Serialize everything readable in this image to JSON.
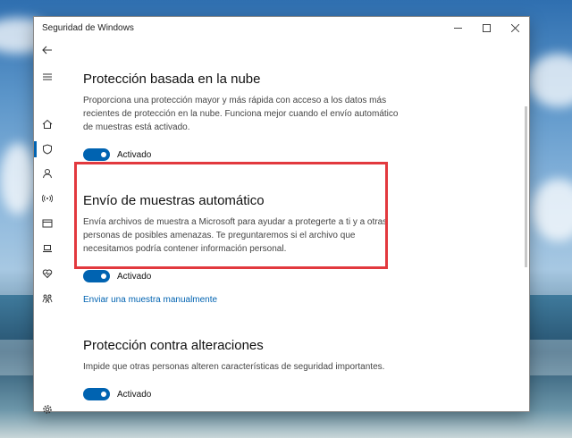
{
  "window": {
    "title": "Seguridad de Windows",
    "controls": [
      "minimize-icon",
      "maximize-icon",
      "close-icon"
    ]
  },
  "nav": {
    "items": [
      {
        "icon": "back-arrow-icon"
      },
      {
        "icon": "hamburger-menu-icon"
      },
      {
        "icon": "home-icon"
      },
      {
        "icon": "shield-icon",
        "active": true
      },
      {
        "icon": "account-icon"
      },
      {
        "icon": "wifi-antenna-icon"
      },
      {
        "icon": "app-browser-icon"
      },
      {
        "icon": "laptop-icon"
      },
      {
        "icon": "heart-health-icon"
      },
      {
        "icon": "family-icon"
      },
      {
        "icon": "gear-icon"
      }
    ]
  },
  "sections": [
    {
      "title": "Protección basada en la nube",
      "description": "Proporciona una protección mayor y más rápida con acceso a los datos más recientes de protección en la nube. Funciona mejor cuando el envío automático de muestras está activado.",
      "toggle_label": "Activado",
      "toggle_on": true
    },
    {
      "title": "Envío de muestras automático",
      "description": "Envía archivos de muestra a Microsoft para ayudar a protegerte a ti y a otras personas de posibles amenazas. Te preguntaremos si el archivo que necesitamos podría contener información personal.",
      "toggle_label": "Activado",
      "toggle_on": true,
      "link": "Enviar una muestra manualmente"
    },
    {
      "title": "Protección contra alteraciones",
      "description": "Impide que otras personas alteren características de seguridad importantes.",
      "toggle_label": "Activado",
      "toggle_on": true
    }
  ],
  "colors": {
    "accent": "#0063b1",
    "highlight": "#e2393e"
  }
}
